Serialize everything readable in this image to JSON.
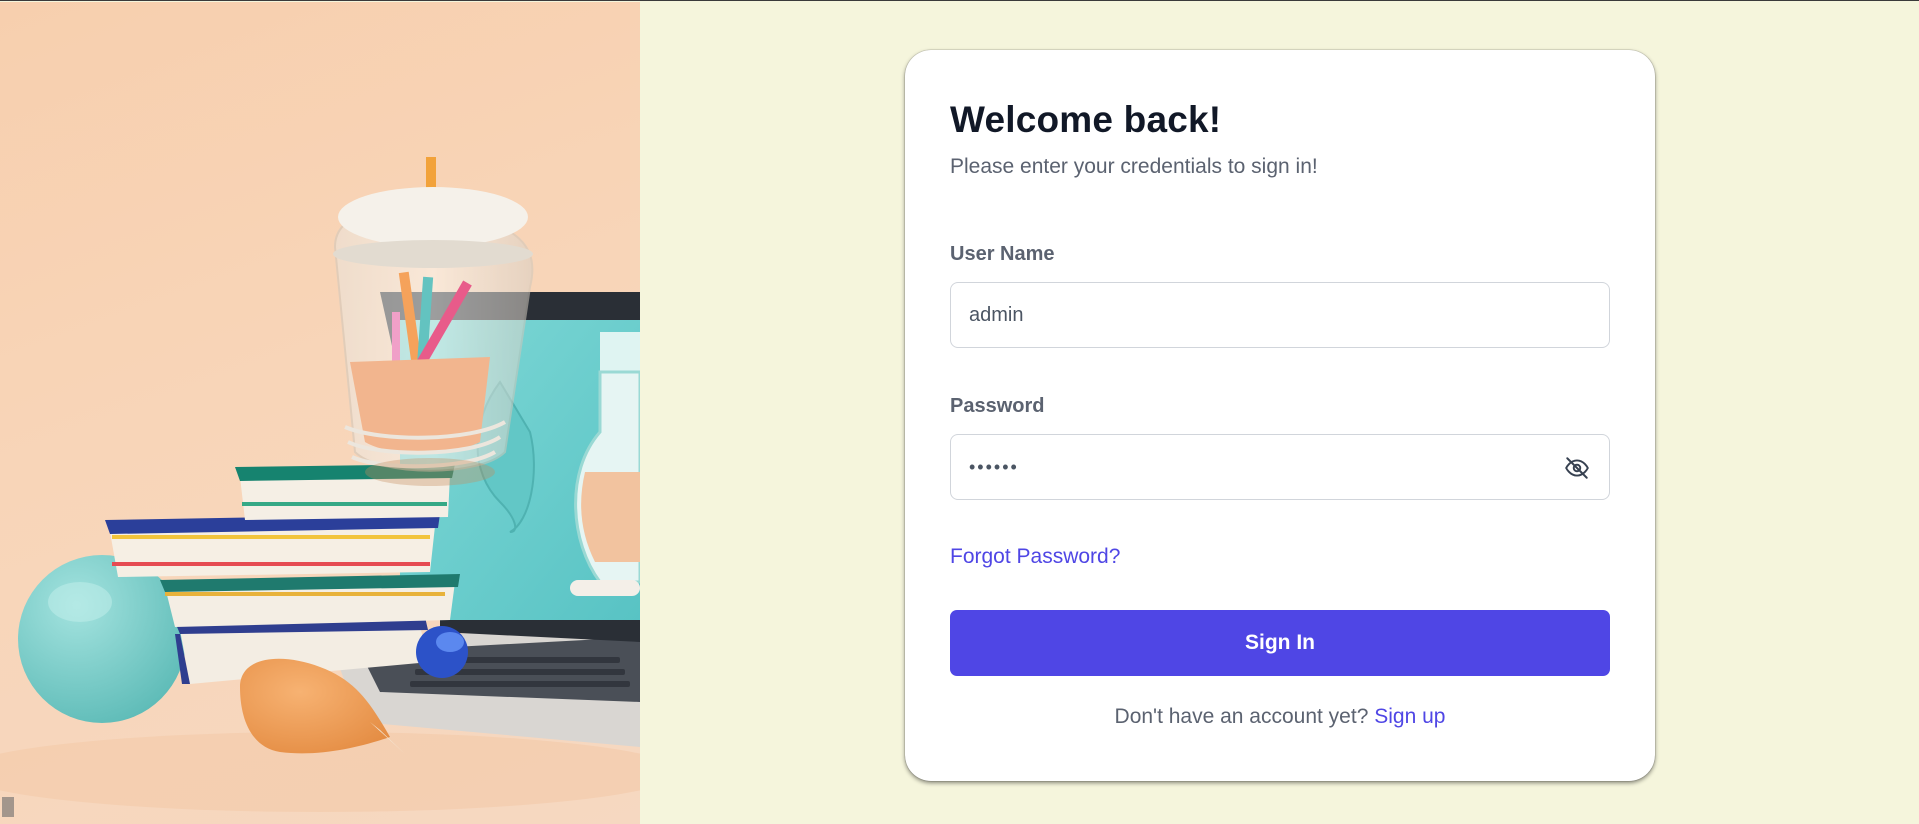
{
  "login": {
    "title": "Welcome back!",
    "subtitle": "Please enter your credentials to sign in!",
    "username_label": "User Name",
    "username_value": "admin",
    "password_label": "Password",
    "password_value": "••••••",
    "forgot_link": "Forgot Password?",
    "signin_button": "Sign In",
    "no_account_text": "Don't have an account yet?",
    "signup_link": "Sign up"
  },
  "icons": {
    "password_toggle": "eye-off-icon"
  },
  "colors": {
    "page_background": "#f5f5dc",
    "card_background": "#ffffff",
    "accent": "#4f46e5",
    "heading": "#111827",
    "muted_text": "#5b6270",
    "input_border": "#d1d5db"
  }
}
